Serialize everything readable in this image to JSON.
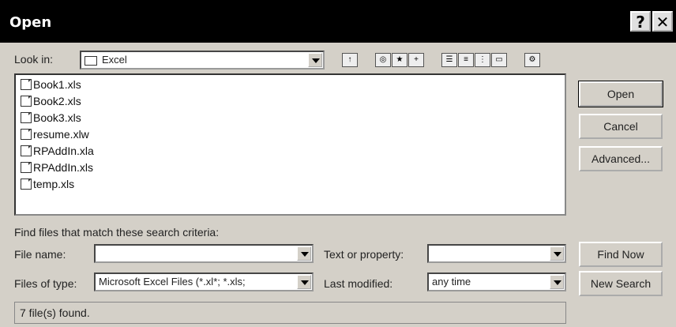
{
  "window": {
    "title": "Open",
    "help_glyph": "?",
    "close_glyph": "✕"
  },
  "lookin": {
    "label": "Look in:",
    "value": "Excel"
  },
  "files": [
    "Book1.xls",
    "Book2.xls",
    "Book3.xls",
    "resume.xlw",
    "RPAddIn.xla",
    "RPAddIn.xls",
    "temp.xls"
  ],
  "buttons": {
    "open": "Open",
    "cancel": "Cancel",
    "advanced": "Advanced...",
    "find_now": "Find Now",
    "new_search": "New Search"
  },
  "search": {
    "criteria_heading": "Find files that match these search criteria:",
    "file_name_label": "File name:",
    "file_name_value": "",
    "files_of_type_label": "Files of type:",
    "files_of_type_value": "Microsoft Excel Files (*.xl*; *.xls;",
    "text_property_label": "Text or property:",
    "text_property_value": "",
    "last_modified_label": "Last modified:",
    "last_modified_value": "any time"
  },
  "status": "7 file(s) found."
}
